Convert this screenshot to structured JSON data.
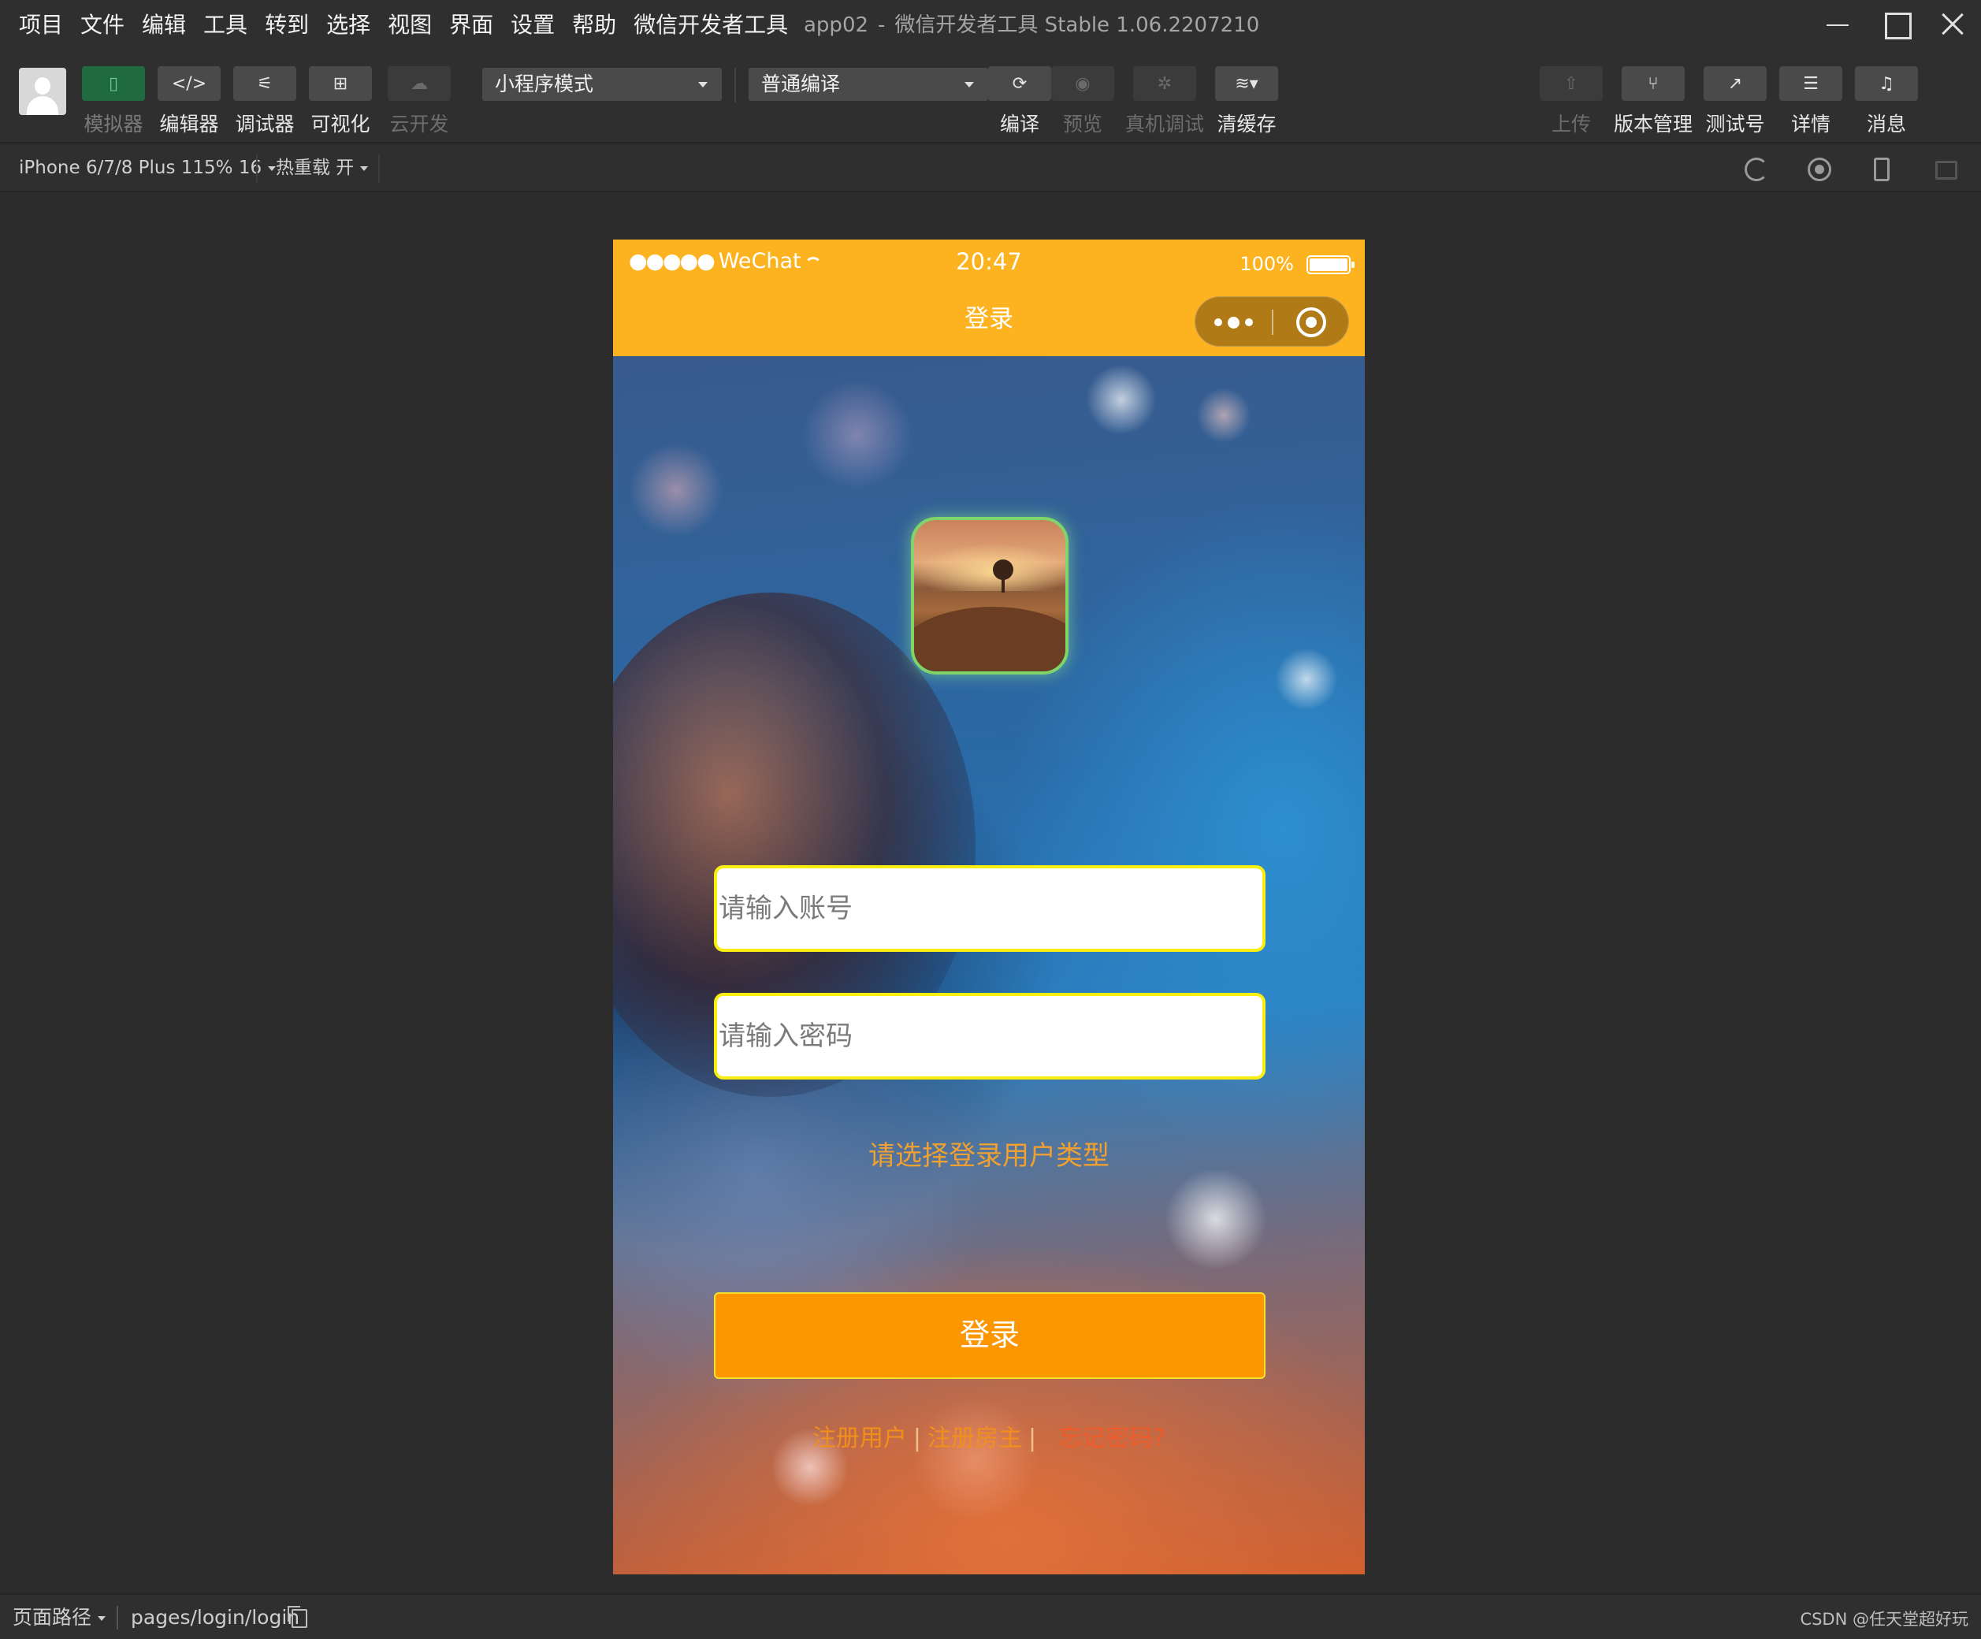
{
  "menu": [
    "项目",
    "文件",
    "编辑",
    "工具",
    "转到",
    "选择",
    "视图",
    "界面",
    "设置",
    "帮助",
    "微信开发者工具"
  ],
  "app_title": {
    "project": "app02",
    "separator": "-",
    "product": "微信开发者工具 Stable 1.06.2207210"
  },
  "toolbar": {
    "left_tools": [
      "模拟器",
      "编辑器",
      "调试器",
      "可视化",
      "云开发"
    ],
    "mode_select": "小程序模式",
    "compile_select": "普通编译",
    "center_tools": [
      "编译",
      "预览",
      "真机调试",
      "清缓存"
    ],
    "right_tools": [
      "上传",
      "版本管理",
      "测试号",
      "详情",
      "消息"
    ]
  },
  "device_bar": {
    "device": "iPhone 6/7/8 Plus 115% 16",
    "hot_reload": "热重载 开"
  },
  "phone": {
    "statusbar": {
      "carrier": "WeChat",
      "signal_dots": "●●●●●",
      "time": "20:47",
      "battery": "100%",
      "battery_level": 1.0
    },
    "nav_title": "登录",
    "account_placeholder": "请输入账号",
    "password_placeholder": "请输入密码",
    "user_type_prompt": "请选择登录用户类型",
    "login_button": "登录",
    "links": {
      "register_user": "注册用户",
      "register_owner": "注册房主",
      "forgot_password": "忘记密码?",
      "divider": "|"
    }
  },
  "bottom_bar": {
    "path_label": "页面路径",
    "path": "pages/login/login",
    "watermark": "CSDN @任天堂超好玩"
  },
  "colors": {
    "theme_orange": "#fdb220",
    "button_orange": "#fc9601",
    "field_border": "#f8ef10",
    "prompt_text": "#f0a030"
  }
}
